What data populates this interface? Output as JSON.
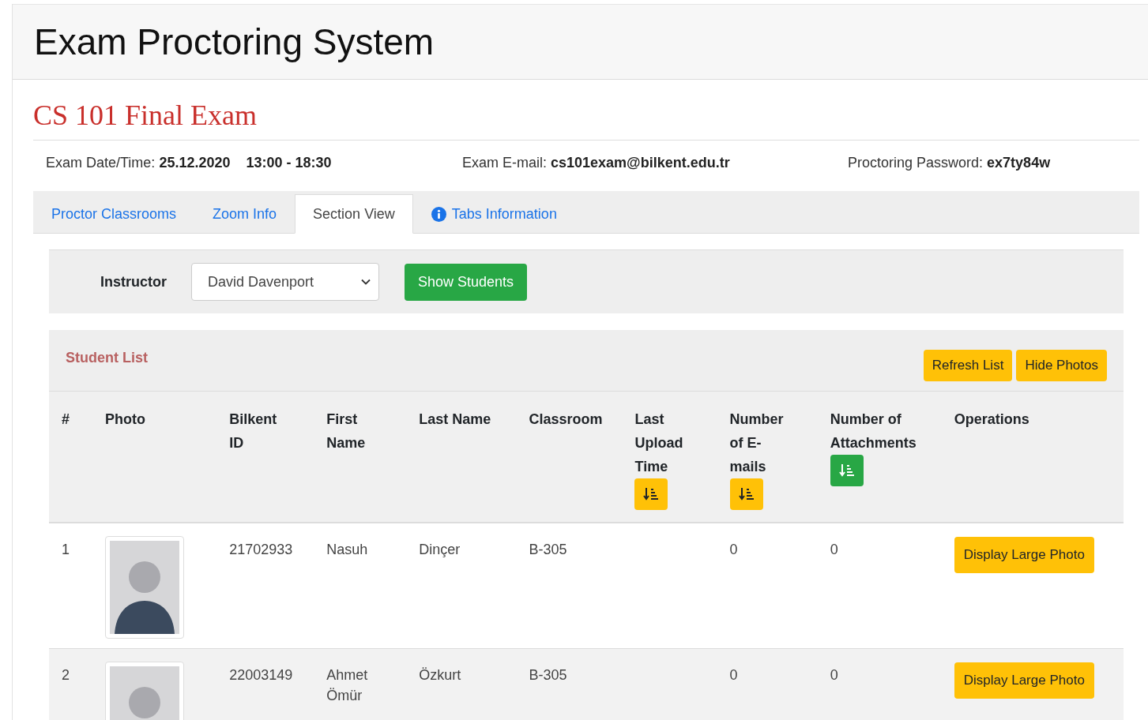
{
  "app_title": "Exam Proctoring System",
  "exam_title": "CS 101 Final Exam",
  "info": [
    {
      "label": "Exam Date/Time:",
      "value": "25.12.2020",
      "extra": "13:00 - 18:30"
    },
    {
      "label": "Exam E-mail:",
      "value": "cs101exam@bilkent.edu.tr"
    },
    {
      "label": "Proctoring Password:",
      "value": "ex7ty84w"
    }
  ],
  "tabs": [
    {
      "label": "Proctor Classrooms",
      "selected": false,
      "info_icon": false
    },
    {
      "label": "Zoom Info",
      "selected": false,
      "info_icon": false
    },
    {
      "label": "Section View",
      "selected": true,
      "info_icon": false
    },
    {
      "label": "Tabs Information",
      "selected": false,
      "info_icon": true
    }
  ],
  "filter": {
    "label": "Instructor",
    "value": "David Davenport",
    "button": "Show Students"
  },
  "student_list": {
    "title": "Student List",
    "buttons": [
      "Refresh List",
      "Hide Photos"
    ],
    "columns": [
      {
        "label": "#"
      },
      {
        "label": "Photo"
      },
      {
        "label": "Bilkent ID"
      },
      {
        "label": "First Name"
      },
      {
        "label": "Last Name"
      },
      {
        "label": "Classroom"
      },
      {
        "label": "Last Upload Time",
        "sort": {
          "active": false
        }
      },
      {
        "label": "Number of E-mails",
        "sort": {
          "active": false
        }
      },
      {
        "label": "Number of Attachments",
        "sort": {
          "active": true
        }
      },
      {
        "label": "Operations"
      }
    ],
    "rows": [
      {
        "index": "1",
        "id": "21702933",
        "first_name": "Nasuh",
        "last_name": "Dinçer",
        "classroom": "B-305",
        "emails": "0",
        "attachments": "0",
        "action": "Display Large Photo"
      },
      {
        "index": "2",
        "id": "22003149",
        "first_name": "Ahmet Ömür",
        "last_name": "Özkurt",
        "classroom": "B-305",
        "emails": "0",
        "attachments": "0",
        "action": "Display Large Photo"
      }
    ]
  }
}
